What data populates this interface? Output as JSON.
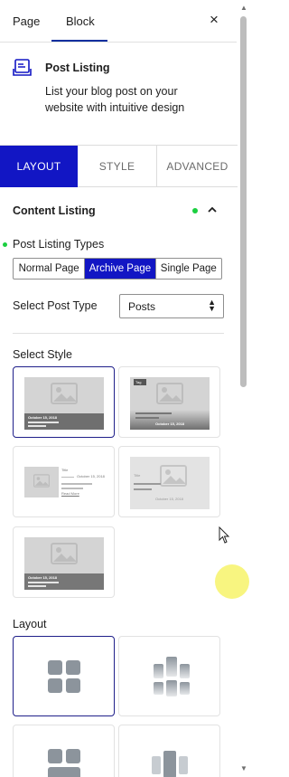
{
  "top_tabs": {
    "page": "Page",
    "block": "Block",
    "close": "×"
  },
  "block_info": {
    "title": "Post Listing",
    "description": "List your blog post on your website with intuitive design"
  },
  "panel_tabs": [
    "LAYOUT",
    "STYLE",
    "ADVANCED"
  ],
  "content_listing": {
    "heading": "Content Listing",
    "types_label": "Post Listing Types",
    "types": [
      "Normal Page",
      "Archive Page",
      "Single Page"
    ],
    "active_type": "Archive Page",
    "post_type_label": "Select Post Type",
    "post_type_value": "Posts"
  },
  "select_style": {
    "label": "Select Style",
    "card_date": "October 15, 2018",
    "card_title": "Title",
    "card_readmore": "Read More",
    "card_tag": "Tag",
    "selected_index": 0
  },
  "layout_section": {
    "label": "Layout",
    "selected_index": 0
  },
  "colors": {
    "accent": "#1216c4",
    "status_dot": "#1bcf40",
    "placeholder": "#d4d4d4"
  }
}
